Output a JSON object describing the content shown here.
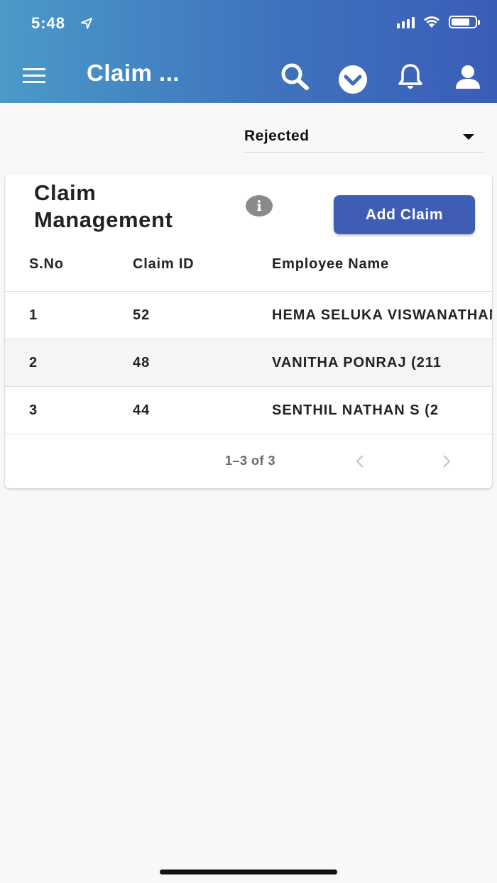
{
  "status_bar": {
    "time": "5:48"
  },
  "header": {
    "title": "Claim ..."
  },
  "filter": {
    "selected": "Rejected"
  },
  "card": {
    "title": "Claim Management",
    "add_button": "Add Claim",
    "info_glyph": "i"
  },
  "table": {
    "columns": [
      "S.No",
      "Claim ID",
      "Employee Name"
    ],
    "rows": [
      {
        "sno": "1",
        "claim_id": "52",
        "employee": "HEMA SELUKA VISWANATHAN"
      },
      {
        "sno": "2",
        "claim_id": "48",
        "employee": "VANITHA PONRAJ (211"
      },
      {
        "sno": "3",
        "claim_id": "44",
        "employee": "SENTHIL NATHAN S (2"
      }
    ]
  },
  "pagination": {
    "range": "1–3 of 3"
  },
  "icons": [
    "location-arrow-icon",
    "signal-icon",
    "wifi-icon",
    "battery-icon",
    "menu-icon",
    "search-icon",
    "chevron-down-circle-icon",
    "bell-icon",
    "user-icon",
    "info-icon",
    "chevron-left-icon",
    "chevron-right-icon"
  ],
  "colors": {
    "appbar_start": "#4a9ac9",
    "appbar_end": "#3a5db8",
    "button": "#3f5db5"
  }
}
